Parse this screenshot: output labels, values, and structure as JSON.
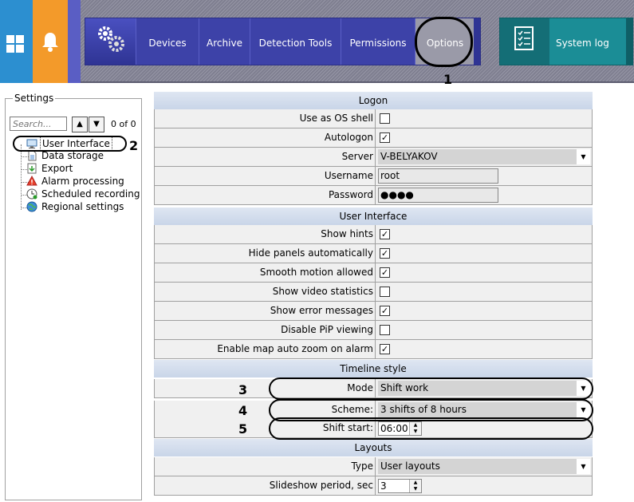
{
  "topbar": {
    "nav": [
      "Devices",
      "Archive",
      "Detection Tools",
      "Permissions",
      "Options"
    ],
    "system_log": "System log"
  },
  "callouts": [
    "1",
    "2",
    "3",
    "4",
    "5"
  ],
  "settings": {
    "legend": "Settings",
    "search_placeholder": "Search...",
    "counter": "0 of 0",
    "tree": [
      {
        "label": "User Interface",
        "icon": "monitor-icon"
      },
      {
        "label": "Data storage",
        "icon": "file-icon"
      },
      {
        "label": "Export",
        "icon": "export-icon"
      },
      {
        "label": "Alarm processing",
        "icon": "alarm-icon"
      },
      {
        "label": "Scheduled recording",
        "icon": "schedule-icon"
      },
      {
        "label": "Regional settings",
        "icon": "globe-icon"
      }
    ]
  },
  "logon": {
    "title": "Logon",
    "use_os_shell": {
      "label": "Use as OS shell",
      "checked": false
    },
    "autologon": {
      "label": "Autologon",
      "checked": true
    },
    "server": {
      "label": "Server",
      "value": "V-BELYAKOV"
    },
    "username": {
      "label": "Username",
      "value": "root"
    },
    "password": {
      "label": "Password",
      "value": "●●●●"
    }
  },
  "user_interface": {
    "title": "User Interface",
    "rows": [
      {
        "label": "Show hints",
        "checked": true
      },
      {
        "label": "Hide panels automatically",
        "checked": true
      },
      {
        "label": "Smooth motion allowed",
        "checked": true
      },
      {
        "label": "Show video statistics",
        "checked": false
      },
      {
        "label": "Show error messages",
        "checked": true
      },
      {
        "label": "Disable PiP viewing",
        "checked": false
      },
      {
        "label": "Enable map auto zoom on alarm",
        "checked": true
      }
    ]
  },
  "timeline": {
    "title": "Timeline style",
    "mode": {
      "label": "Mode",
      "value": "Shift work"
    },
    "scheme": {
      "label": "Scheme:",
      "value": "3 shifts of 8 hours"
    },
    "shift_start": {
      "label": "Shift start:",
      "value": "06:00"
    }
  },
  "layouts": {
    "title": "Layouts",
    "type": {
      "label": "Type",
      "value": "User layouts"
    },
    "slideshow": {
      "label": "Slideshow period, sec",
      "value": "3"
    }
  },
  "colors": {
    "options_tab": "#9a9aa8",
    "nav_bg": "#3d42a8",
    "syslog_bg": "#1b8d96",
    "section_header": "#d3dcec"
  }
}
